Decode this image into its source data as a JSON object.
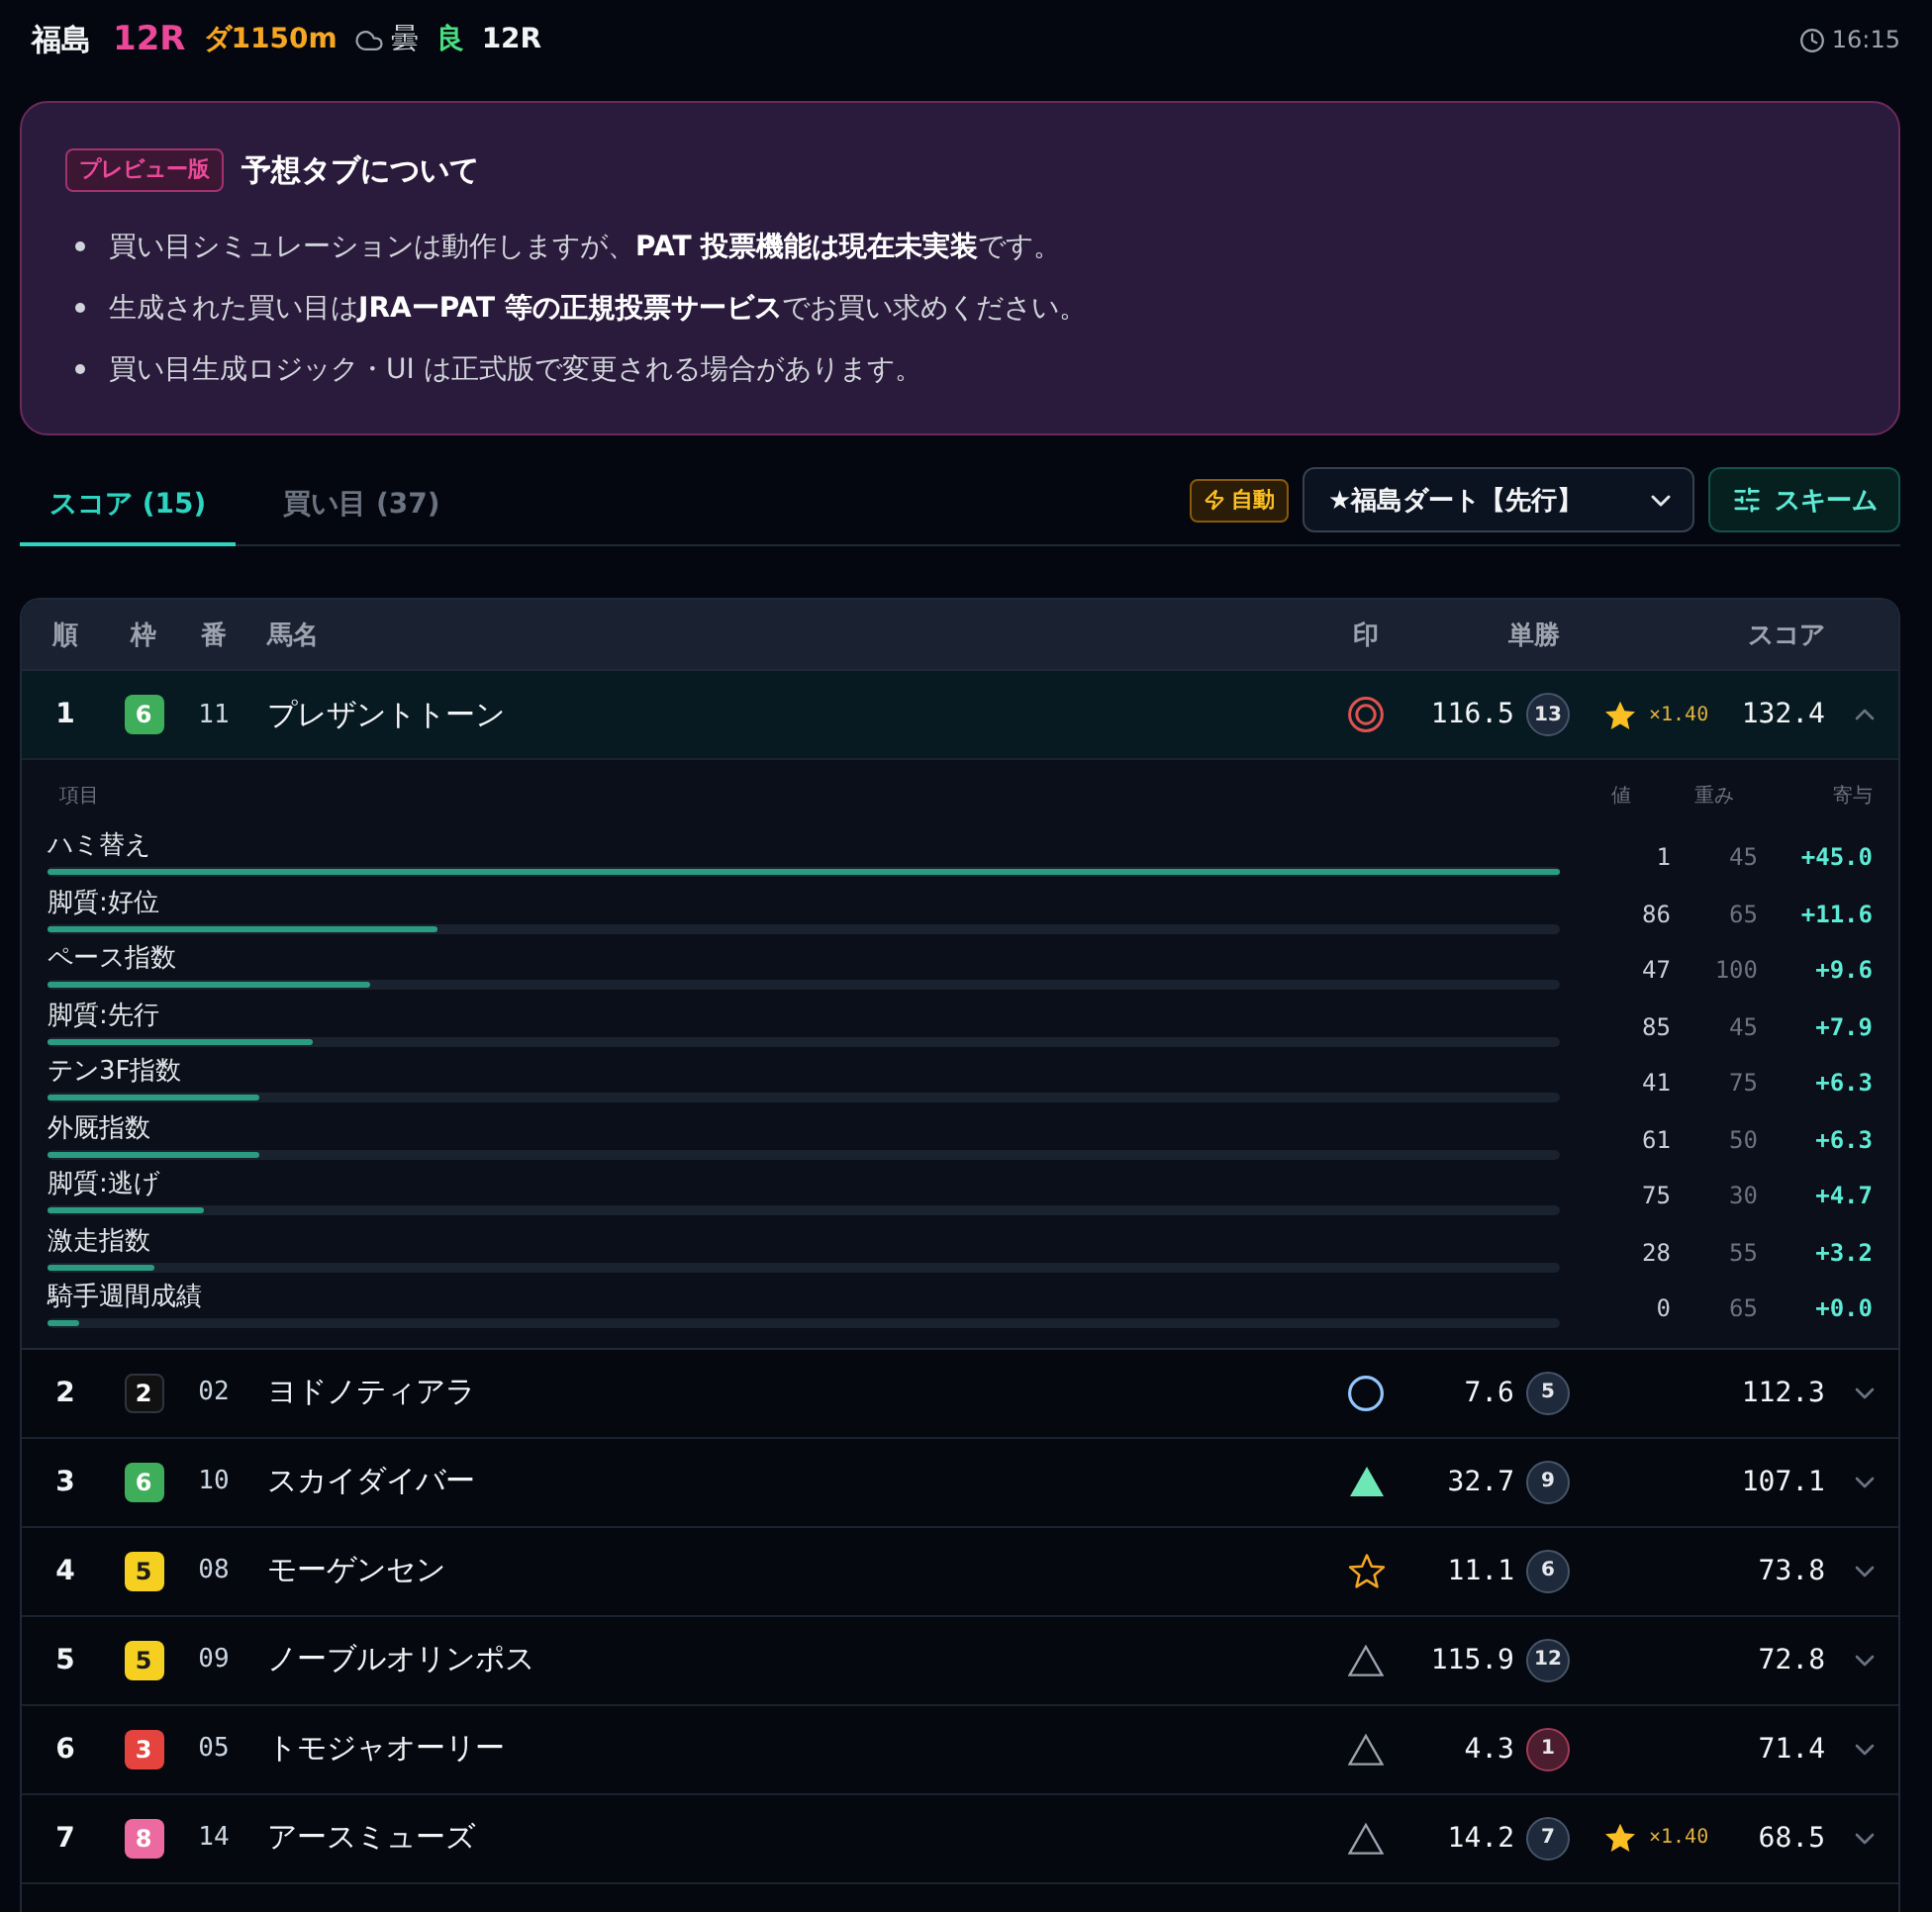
{
  "header": {
    "venue": "福島",
    "race": "12R",
    "course": "ダ1150m",
    "weather": "曇",
    "going": "良",
    "race_label": "12R",
    "time": "16:15"
  },
  "notice": {
    "badge": "プレビュー版",
    "title": "予想タブについて",
    "items": [
      "買い目シミュレーションは動作しますが、**PAT 投票機能は現在未実装**です。",
      "生成された買い目は**JRAーPAT 等の正規投票サービス**でお買い求めください。",
      "買い目生成ロジック・UI は正式版で変更される場合があります。"
    ]
  },
  "tabs": [
    {
      "label": "スコア (15)",
      "selected": true
    },
    {
      "label": "買い目 (37)",
      "selected": false
    }
  ],
  "controls": {
    "auto_badge": "自動",
    "preset": "★福島ダート【先行】",
    "scheme_button": "スキーム"
  },
  "table": {
    "columns": [
      "順",
      "枠",
      "番",
      "馬名",
      "印",
      "単勝",
      "スコア"
    ],
    "rows": [
      {
        "rank": "1",
        "frame": {
          "label": "6",
          "color": "#3fae5a"
        },
        "number": "11",
        "name": "プレザントトーン",
        "mark": {
          "kind": "double_circle",
          "color": "#e0524f"
        },
        "odds": "116.5",
        "popularity": "13",
        "favorite": false,
        "bonus": "×1.40",
        "score": "132.4",
        "expanded": true,
        "breakdown": {
          "columns": [
            "項目",
            "値",
            "重み",
            "寄与"
          ],
          "items": [
            {
              "label": "ハミ替え",
              "level": 1,
              "value": "1",
              "weight": "45",
              "contribution": "+45.0"
            },
            {
              "label": "脚質:好位",
              "level": 0.258,
              "value": "86",
              "weight": "65",
              "contribution": "+11.6"
            },
            {
              "label": "ペース指数",
              "level": 0.213,
              "value": "47",
              "weight": "100",
              "contribution": "+9.6"
            },
            {
              "label": "脚質:先行",
              "level": 0.176,
              "value": "85",
              "weight": "45",
              "contribution": "+7.9"
            },
            {
              "label": "テン3F指数",
              "level": 0.14,
              "value": "41",
              "weight": "75",
              "contribution": "+6.3"
            },
            {
              "label": "外厩指数",
              "level": 0.14,
              "value": "61",
              "weight": "50",
              "contribution": "+6.3"
            },
            {
              "label": "脚質:逃げ",
              "level": 0.104,
              "value": "75",
              "weight": "30",
              "contribution": "+4.7"
            },
            {
              "label": "激走指数",
              "level": 0.071,
              "value": "28",
              "weight": "55",
              "contribution": "+3.2"
            },
            {
              "label": "騎手週間成績",
              "level": 0.021,
              "value": "0",
              "weight": "65",
              "contribution": "+0.0"
            }
          ]
        }
      },
      {
        "rank": "2",
        "frame": {
          "label": "2",
          "color": "#111111"
        },
        "number": "02",
        "name": "ヨドノティアラ",
        "mark": {
          "kind": "circle",
          "color": "#93c5fd"
        },
        "odds": "7.6",
        "popularity": "5",
        "favorite": false,
        "score": "112.3",
        "expanded": false
      },
      {
        "rank": "3",
        "frame": {
          "label": "6",
          "color": "#3fae5a"
        },
        "number": "10",
        "name": "スカイダイバー",
        "mark": {
          "kind": "filled_triangle",
          "color": "#6ee7b7"
        },
        "odds": "32.7",
        "popularity": "9",
        "favorite": false,
        "score": "107.1",
        "expanded": false
      },
      {
        "rank": "4",
        "frame": {
          "label": "5",
          "color": "#f5d020"
        },
        "number": "08",
        "name": "モーゲンセン",
        "mark": {
          "kind": "star",
          "color": "#f5a623"
        },
        "odds": "11.1",
        "popularity": "6",
        "favorite": false,
        "score": "73.8",
        "expanded": false
      },
      {
        "rank": "5",
        "frame": {
          "label": "5",
          "color": "#f5d020"
        },
        "number": "09",
        "name": "ノーブルオリンポス",
        "mark": {
          "kind": "triangle",
          "color": "#9ca3af"
        },
        "odds": "115.9",
        "popularity": "12",
        "favorite": false,
        "score": "72.8",
        "expanded": false
      },
      {
        "rank": "6",
        "frame": {
          "label": "3",
          "color": "#e5433d"
        },
        "number": "05",
        "name": "トモジャオーリー",
        "mark": {
          "kind": "triangle",
          "color": "#9ca3af"
        },
        "odds": "4.3",
        "popularity": "1",
        "favorite": true,
        "score": "71.4",
        "expanded": false
      },
      {
        "rank": "7",
        "frame": {
          "label": "8",
          "color": "#ec6a9f"
        },
        "number": "14",
        "name": "アースミューズ",
        "mark": {
          "kind": "triangle",
          "color": "#9ca3af"
        },
        "odds": "14.2",
        "popularity": "7",
        "favorite": false,
        "bonus": "×1.40",
        "score": "68.5",
        "expanded": false
      }
    ]
  }
}
